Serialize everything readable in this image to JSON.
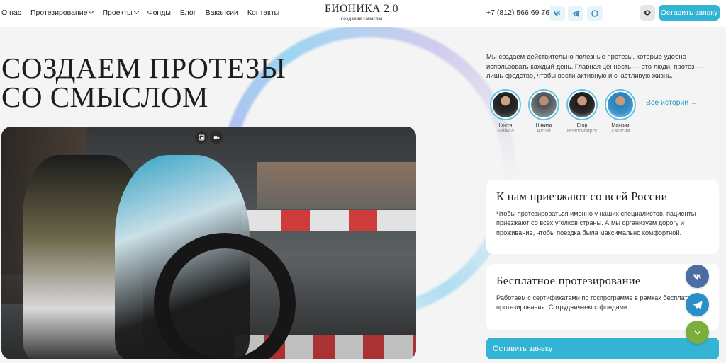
{
  "header": {
    "nav": [
      {
        "label": "О нас",
        "dropdown": false
      },
      {
        "label": "Протезирование",
        "dropdown": true
      },
      {
        "label": "Проекты",
        "dropdown": true
      },
      {
        "label": "Фонды",
        "dropdown": false
      },
      {
        "label": "Блог",
        "dropdown": false
      },
      {
        "label": "Вакансии",
        "dropdown": false
      },
      {
        "label": "Контакты",
        "dropdown": false
      }
    ],
    "logo_title": "БИОНИКА 2.0",
    "logo_subtitle": "создавая смыслы",
    "phone": "+7 (812) 566 69 76",
    "social_icons": [
      "vk-icon",
      "telegram-icon",
      "max-icon"
    ],
    "accessibility_icon": "eye-icon",
    "cta_label": "Оставить заявку"
  },
  "hero": {
    "title_line1": "СОЗДАЕМ ПРОТЕЗЫ",
    "title_line2": "СО СМЫСЛОМ",
    "video_controls": [
      "pip-icon",
      "video-icon"
    ]
  },
  "intro_text": "Мы создаем действительно полезные протезы, которые удобно использовать каждый день. Главная ценность — это люди, протез — лишь средство, чтобы вести активную и счастливую жизнь.",
  "stories": [
    {
      "name": "Костя",
      "place": "Байкал"
    },
    {
      "name": "Никита",
      "place": "Алтай"
    },
    {
      "name": "Егор",
      "place": "Новосибирск"
    },
    {
      "name": "Максим",
      "place": "Хакасия"
    }
  ],
  "all_stories_label": "Все истории →",
  "cards": [
    {
      "title": "К нам приезжают со всей России",
      "text": "Чтобы протезироваться именно у наших специалистов, пациенты приезжают со всех уголков страны. А мы организуем дорогу и проживание, чтобы поездка была максимально комфортной."
    },
    {
      "title": "Бесплатное протезирование",
      "text": "Работаем с сертификатами по госпрограмме в рамках бесплатного протезирования. Сотрудничаем с фондами."
    }
  ],
  "bottom_cta": {
    "label": "Оставить заявку",
    "arrow": "→"
  },
  "floating_buttons": [
    "vk-icon",
    "telegram-icon",
    "chevron-down-icon"
  ],
  "colors": {
    "accent": "#33b4d4",
    "vk": "#4a6da3",
    "telegram": "#2a8fc7",
    "green": "#7cae3b"
  }
}
